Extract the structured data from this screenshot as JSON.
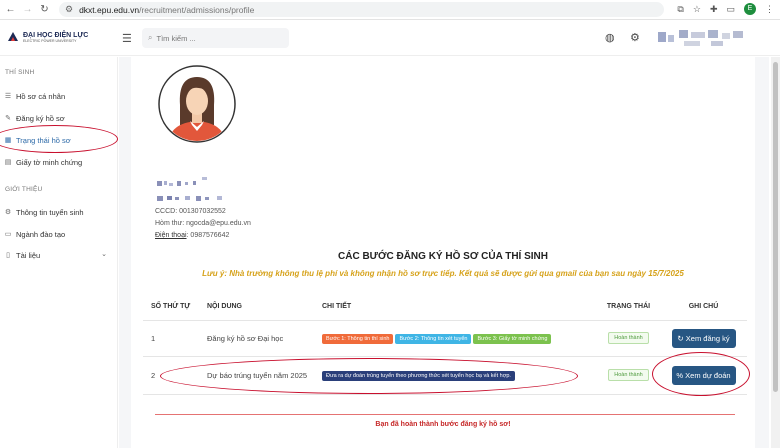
{
  "browser": {
    "url_host": "dkxt.epu.edu.vn",
    "url_path": "/recruitment/admissions/profile",
    "profile_initial": "E"
  },
  "header": {
    "logo_title": "ĐẠI HỌC ĐIỆN LỰC",
    "logo_subtitle": "ELECTRIC POWER UNIVERSITY",
    "search_placeholder": "Tìm kiếm ..."
  },
  "sidebar": {
    "section_candidate": "THÍ SINH",
    "items": [
      {
        "label": "Hồ sơ cá nhân",
        "icon": "list-icon"
      },
      {
        "label": "Đăng ký hồ sơ",
        "icon": "edit-icon"
      },
      {
        "label": "Trạng thái hồ sơ",
        "icon": "calendar-icon",
        "active": true
      },
      {
        "label": "Giấy tờ minh chứng",
        "icon": "file-icon"
      }
    ],
    "section_intro": "GIỚI THIỆU",
    "intro_items": [
      {
        "label": "Thông tin tuyển sinh",
        "icon": "gear-icon"
      },
      {
        "label": "Ngành đào tạo",
        "icon": "book-icon"
      },
      {
        "label": "Tài liệu",
        "icon": "document-icon"
      }
    ]
  },
  "profile": {
    "cccd": "CCCD: 001307032552",
    "email": "Hòm thư: ngocda@epu.edu.vn",
    "phone_label": "Điện thoại",
    "phone_value": ": 0987576642"
  },
  "steps": {
    "title": "CÁC BƯỚC ĐĂNG KÝ HỒ SƠ CỦA THÍ SINH",
    "notice": "Lưu ý: Nhà trường không thu lệ phí và không nhận hồ sơ trực tiếp. Kết quả sẽ được gửi qua gmail của bạn sau ngày 15/7/2025",
    "columns": [
      "SỐ THỨ TỰ",
      "NỘI DUNG",
      "CHI TIẾT",
      "TRẠNG THÁI",
      "GHI CHÚ"
    ],
    "rows": [
      {
        "no": "1",
        "content": "Đăng ký hồ sơ Đại học",
        "tags": [
          {
            "text": "Bước 1: Thông tin thí sinh",
            "color": "#f06b3a"
          },
          {
            "text": "Bước 2: Thông tin xét tuyển",
            "color": "#3fb5e5"
          },
          {
            "text": "Bước 3: Giấy tờ minh chứng",
            "color": "#7cc24e"
          }
        ],
        "status": "Hoàn thành",
        "action": "Xem đăng ký",
        "action_icon": "refresh-icon"
      },
      {
        "no": "2",
        "content": "Dự báo trúng tuyển năm 2025",
        "tags": [
          {
            "text": "Đưa ra dự đoán trúng tuyển theo phương thức xét tuyển học bạ và kết hợp.",
            "color": "#2a3f7a"
          }
        ],
        "status": "Hoàn thành",
        "action": "Xem dự đoán",
        "action_icon": "percent-icon"
      }
    ],
    "done_message": "Bạn đã hoàn thành bước đăng ký hồ sơ!"
  },
  "colors": {
    "accent": "#275683",
    "annotation": "#c8102e",
    "notice": "#d6a21a"
  }
}
